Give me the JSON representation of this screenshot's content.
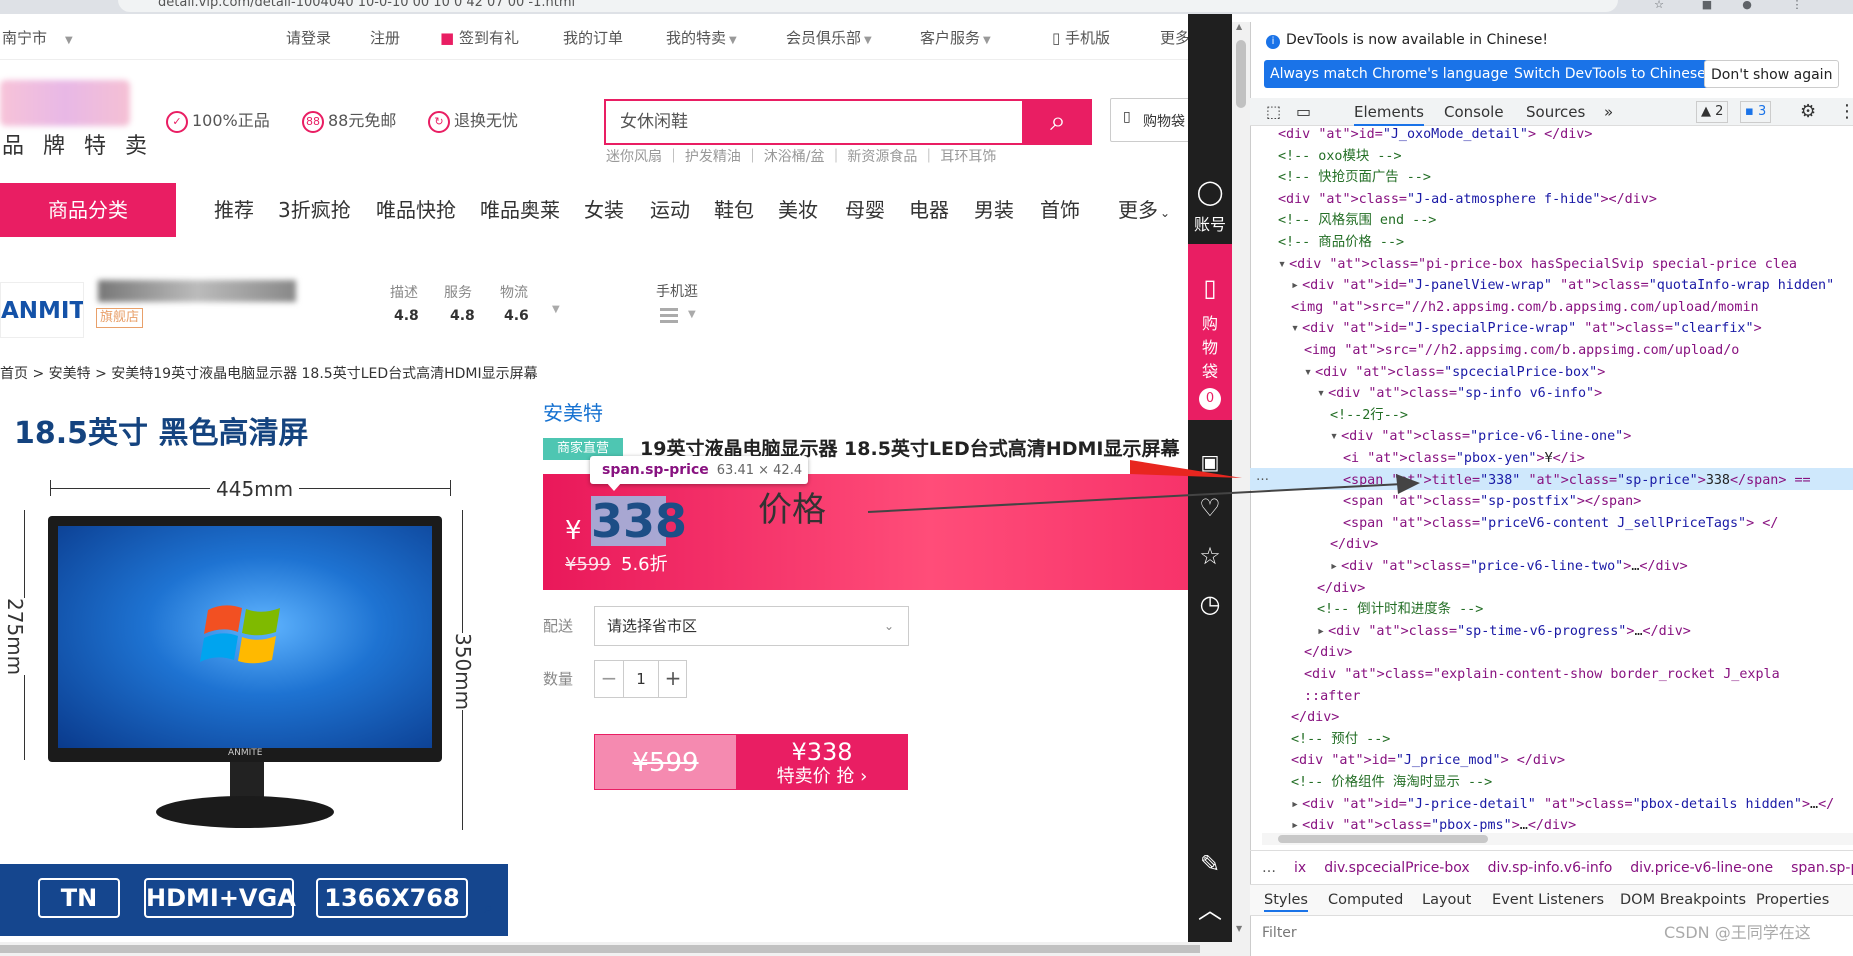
{
  "browser": {
    "url": "detail.vip.com/detail-1004040 10-0-10 00 10 0 42 07 00 -1.html"
  },
  "topnav": {
    "city": "南宁市",
    "login": "请登录",
    "register": "注册",
    "signin": "签到有礼",
    "orders": "我的订单",
    "my_special": "我的特卖",
    "club": "会员俱乐部",
    "service": "客户服务",
    "mobile": "手机版",
    "more": "更多"
  },
  "header": {
    "logo_text": "品 牌 特 卖",
    "promise_1": "100%正品",
    "promise_2": "88元免邮",
    "promise_3": "退换无忧",
    "search_value": "女休闲鞋",
    "hotwords": "迷你风扇 ｜ 护发精油 ｜ 沐浴桶/盆 ｜ 新资源食品 ｜ 耳环耳饰",
    "cart": "购物袋"
  },
  "categories": {
    "main": "商品分类",
    "items": [
      "推荐",
      "3折疯抢",
      "唯品快抢",
      "唯品奥莱",
      "女装",
      "运动",
      "鞋包",
      "美妆",
      "母婴",
      "电器",
      "男装",
      "首饰"
    ],
    "more": "更多"
  },
  "store": {
    "logo": "ANMITE",
    "flag": "旗舰店",
    "labels": [
      "描述",
      "服务",
      "物流"
    ],
    "scores": [
      "4.8",
      "4.8",
      "4.6"
    ],
    "mobile_label": "手机逛"
  },
  "breadcrumb": "首页 > 安美特 > 安美特19英寸液晶电脑显示器 18.5英寸LED台式高清HDMI显示屏幕",
  "image": {
    "title": "18.5英寸 黑色高清屏",
    "width": "445mm",
    "height_left": "275mm",
    "height_right": "350mm",
    "brand_on_stand": "ANMITE",
    "specs": [
      "TN",
      "HDMI+VGA",
      "1366X768"
    ]
  },
  "product": {
    "brand": "安美特",
    "tag": "商家直营",
    "title": "19英寸液晶电脑显示器 18.5英寸LED台式高清HDMI显示屏幕",
    "yen": "¥",
    "price": "338",
    "orig_price": "¥599",
    "discount": "5.6折",
    "annotation": "价格",
    "tooltip_selector": "span.sp-price",
    "tooltip_dims": "63.41 × 42.4",
    "ship_label": "配送",
    "ship_placeholder": "请选择省市区",
    "qty_label": "数量",
    "qty": "1",
    "qty_minus": "−",
    "qty_plus": "+",
    "buy_orig": "¥599",
    "buy_price": "¥338",
    "buy_label": "特卖价 抢 ›"
  },
  "sidebar": {
    "account": "账号",
    "cart": "购物袋",
    "cart_count": "0"
  },
  "devtools": {
    "info": "DevTools is now available in Chinese!",
    "btn_match": "Always match Chrome's language",
    "btn_switch": "Switch DevTools to Chinese",
    "btn_dont": "Don't show again",
    "tabs": [
      "Elements",
      "Console",
      "Sources"
    ],
    "issues_warn": "2",
    "issues_info": "3",
    "crumbs": [
      "ix",
      "div.spcecialPrice-box",
      "div.sp-info.v6-info",
      "div.price-v6-line-one",
      "span.sp-price"
    ],
    "style_tabs": [
      "Styles",
      "Computed",
      "Layout",
      "Event Listeners",
      "DOM Breakpoints",
      "Properties"
    ],
    "filter": "Filter",
    "lines": [
      {
        "i": 0,
        "html": "<div id=\"J_oxoMode_detail\"> </div>"
      },
      {
        "i": 0,
        "html": "<!-- oxo模块 -->"
      },
      {
        "i": 0,
        "html": "<!-- 快抢页面广告 -->"
      },
      {
        "i": 0,
        "html": "<div class=\"J-ad-atmosphere  f-hide\"></div>"
      },
      {
        "i": 0,
        "html": "<!-- 风格氛围 end -->"
      },
      {
        "i": 0,
        "html": "<!-- 商品价格 -->"
      },
      {
        "i": 0,
        "html": "▾<div class=\"pi-price-box hasSpecialSvip special-price clea"
      },
      {
        "i": 1,
        "html": "▸<div id=\"J-panelView-wrap\" class=\"quotaInfo-wrap hidden\""
      },
      {
        "i": 1,
        "html": "<img src=\"//h2.appsimg.com/b.appsimg.com/upload/momin"
      },
      {
        "i": 1,
        "html": "▾<div id=\"J-specialPrice-wrap\" class=\"clearfix\">"
      },
      {
        "i": 2,
        "html": "<img src=\"//h2.appsimg.com/b.appsimg.com/upload/o"
      },
      {
        "i": 2,
        "html": "▾<div class=\"spcecialPrice-box\">"
      },
      {
        "i": 3,
        "html": "▾<div class=\"sp-info v6-info\">"
      },
      {
        "i": 4,
        "html": "<!--2行-->"
      },
      {
        "i": 4,
        "html": "▾<div class=\"price-v6-line-one\">"
      },
      {
        "i": 5,
        "html": "<i class=\"pbox-yen\">¥</i>"
      },
      {
        "i": 5,
        "html": "<span title=\"338\" class=\"sp-price\">338</span> =="
      },
      {
        "i": 5,
        "html": "<span class=\"sp-postfix\"></span>"
      },
      {
        "i": 5,
        "html": "<span class=\"priceV6-content J_sellPriceTags\"> </"
      },
      {
        "i": 4,
        "html": "</div>"
      },
      {
        "i": 4,
        "html": "▸<div class=\"price-v6-line-two\">…</div>"
      },
      {
        "i": 3,
        "html": "</div>"
      },
      {
        "i": 3,
        "html": "<!-- 倒计时和进度条 -->"
      },
      {
        "i": 3,
        "html": "▸<div class=\"sp-time-v6-progress\">…</div>"
      },
      {
        "i": 2,
        "html": "</div>"
      },
      {
        "i": 2,
        "html": "<div class=\"explain-content-show border_rocket J_expla"
      },
      {
        "i": 2,
        "html": "::after"
      },
      {
        "i": 1,
        "html": "</div>"
      },
      {
        "i": 1,
        "html": "<!-- 预付 -->"
      },
      {
        "i": 1,
        "html": "<div id=\"J_price_mod\"> </div>"
      },
      {
        "i": 1,
        "html": "<!-- 价格组件 海淘时显示 -->"
      },
      {
        "i": 1,
        "html": "▸<div id=\"J-price-detail\" class=\"pbox-details hidden\">…</"
      },
      {
        "i": 1,
        "html": "▸<div class=\"pbox-pms\">…</div>"
      }
    ]
  },
  "watermark": "CSDN @王同学在这",
  "colors": {
    "brand_pink": "#e91e63",
    "devtools_blue": "#1a73e8",
    "highlight": "#cfe8fc"
  }
}
